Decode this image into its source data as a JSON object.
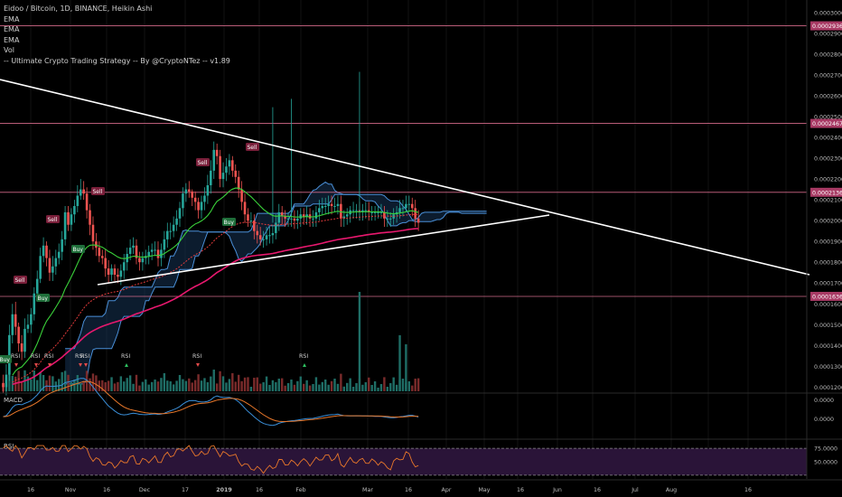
{
  "colors": {
    "background": "#000000",
    "up_candle": "#26a69a",
    "down_candle": "#ef5350",
    "hline": "#d26a8a",
    "price_badge": "#a83a64",
    "cloud": "#4a90d9",
    "ema_fast": "#3ad13a",
    "ema_slow": "#e8186e",
    "trendline": "#ffffff",
    "macd": "#3a8fd9",
    "signal": "#e8772a",
    "rsi": "#e8772a",
    "rsi_band": "#2a1438"
  },
  "header": {
    "title": "Eidoo / Bitcoin, 1D, BINANCE, Heikin Ashi",
    "lines": [
      "EMA",
      "EMA",
      "EMA",
      "Vol",
      "-- Ultimate Crypto Trading Strategy -- By @CryptoNTez -- v1.89"
    ]
  },
  "chart_data": {
    "type": "candlestick",
    "title": "Eidoo / Bitcoin, 1D, BINANCE, Heikin Ashi",
    "price_axis": {
      "ticks": [
        "0.0003000",
        "0.0002900",
        "0.0002800",
        "0.0002700",
        "0.0002600",
        "0.0002500",
        "0.0002400",
        "0.0002300",
        "0.0002200",
        "0.0002100",
        "0.0002000",
        "0.0001900",
        "0.0001800",
        "0.0001700",
        "0.0001600",
        "0.0001500",
        "0.0001400",
        "0.0001300",
        "0.0001200"
      ],
      "range": [
        0.000118,
        0.000306
      ]
    },
    "horizontal_levels": [
      0.0002936,
      0.0002467,
      0.0002136,
      0.0001636
    ],
    "level_labels": [
      "0.0002936",
      "0.0002467",
      "0.0002136",
      "0.0001636"
    ],
    "time_axis": [
      "16",
      "Nov",
      "16",
      "Dec",
      "17",
      "2019",
      "16",
      "Feb",
      "Mar",
      "16",
      "Apr",
      "May",
      "16",
      "Jun",
      "16",
      "Jul",
      "Aug",
      "16"
    ],
    "signals": {
      "sell": [
        "Sell",
        "Sell",
        "Sell",
        "Sell",
        "Sell"
      ],
      "buy": [
        "Buy",
        "Buy",
        "Buy",
        "Buy",
        "Buy"
      ],
      "rsi": [
        "RSI",
        "RSI",
        "RSI",
        "RSI",
        "RSI",
        "RSI",
        "RSI",
        "RSI"
      ]
    },
    "candles": {
      "first_day": "2018-10-05",
      "open": [
        0.000122,
        0.00012,
        0.000126,
        0.000145,
        0.000155,
        0.000149,
        0.000141,
        0.000137,
        0.000148,
        0.00015,
        0.000155,
        0.000165,
        0.000172,
        0.000183,
        0.000188,
        0.000182,
        0.000175,
        0.000178,
        0.000182,
        0.000185,
        0.000191,
        0.000204,
        0.000198,
        0.000203,
        0.000207,
        0.000212,
        0.000215,
        0.000213,
        0.000205,
        0.000198,
        0.00019,
        0.000187,
        0.000183,
        0.000182,
        0.000177,
        0.000174,
        0.000177,
        0.000174,
        0.000173,
        0.000176,
        0.00018,
        0.000184,
        0.000187,
        0.000188,
        0.000182,
        0.00018,
        0.000182,
        0.000183,
        0.000185,
        0.000186,
        0.000186,
        0.000182,
        0.000186,
        0.000191,
        0.000195,
        0.000195,
        0.000198,
        0.000201,
        0.000206,
        0.000213,
        0.000215,
        0.000214,
        0.000211,
        0.000209,
        0.000205,
        0.000209,
        0.000212,
        0.000217,
        0.000224,
        0.000234,
        0.000231,
        0.00022,
        0.000223,
        0.000226,
        0.000229,
        0.000224,
        0.000221,
        0.000215,
        0.000209,
        0.000203,
        0.0002,
        0.0002,
        0.000195,
        0.000193,
        0.000191,
        0.000191,
        0.000193,
        0.000193,
        0.000194,
        0.000199,
        0.000204,
        0.000202,
        0.000201,
        0.000201,
        0.000201,
        0.0002,
        0.000201,
        0.000203,
        0.000202,
        0.000203,
        0.000201,
        0.000201,
        0.000204,
        0.000206,
        0.000207,
        0.000207,
        0.000208,
        0.000207,
        0.000207,
        0.000208,
        0.000201,
        0.000202,
        0.000203,
        0.000205,
        0.000205,
        0.000205,
        0.000204,
        0.000205,
        0.000205,
        0.000204,
        0.000204,
        0.000204,
        0.000204,
        0.000204,
        0.000201,
        0.000201,
        0.000201,
        0.000203,
        0.000204,
        0.000206,
        0.000206,
        0.000208,
        0.000208,
        0.000206,
        0.000201
      ],
      "close": [
        0.00012,
        0.000126,
        0.000145,
        0.000155,
        0.000149,
        0.000141,
        0.000137,
        0.000148,
        0.00015,
        0.000155,
        0.000165,
        0.000172,
        0.000183,
        0.000188,
        0.000182,
        0.000175,
        0.000178,
        0.000182,
        0.000185,
        0.000191,
        0.000204,
        0.000198,
        0.000203,
        0.000207,
        0.000212,
        0.000215,
        0.000213,
        0.000205,
        0.000198,
        0.00019,
        0.000187,
        0.000183,
        0.000182,
        0.000177,
        0.000174,
        0.000177,
        0.000174,
        0.000173,
        0.000176,
        0.00018,
        0.000184,
        0.000187,
        0.000188,
        0.000182,
        0.00018,
        0.000182,
        0.000183,
        0.000185,
        0.000186,
        0.000186,
        0.000182,
        0.000186,
        0.000191,
        0.000195,
        0.000195,
        0.000198,
        0.000201,
        0.000206,
        0.000213,
        0.000215,
        0.000214,
        0.000211,
        0.000209,
        0.000205,
        0.000209,
        0.000212,
        0.000217,
        0.000224,
        0.000234,
        0.000231,
        0.00022,
        0.000223,
        0.000226,
        0.000229,
        0.000224,
        0.000221,
        0.000215,
        0.000209,
        0.000203,
        0.0002,
        0.0002,
        0.000195,
        0.000193,
        0.000191,
        0.000191,
        0.000193,
        0.000193,
        0.000194,
        0.000199,
        0.000204,
        0.000202,
        0.000201,
        0.000201,
        0.000201,
        0.0002,
        0.000201,
        0.000203,
        0.000202,
        0.000203,
        0.000201,
        0.000201,
        0.000204,
        0.000206,
        0.000207,
        0.000207,
        0.000208,
        0.000207,
        0.000207,
        0.000208,
        0.000201,
        0.000202,
        0.000203,
        0.000205,
        0.000205,
        0.000205,
        0.000204,
        0.000205,
        0.000205,
        0.000204,
        0.000204,
        0.000204,
        0.000204,
        0.000204,
        0.000201,
        0.000201,
        0.000201,
        0.000203,
        0.000204,
        0.000206,
        0.000206,
        0.000208,
        0.000208,
        0.000206,
        0.000201,
        0.000199
      ],
      "wick_high": [
        0.000126,
        0.000131,
        0.00015,
        0.00016,
        0.000161,
        0.000151,
        0.000145,
        0.000153,
        0.000155,
        0.000158,
        0.000168,
        0.000176,
        0.000187,
        0.000192,
        0.00019,
        0.000186,
        0.000183,
        0.000186,
        0.000189,
        0.000195,
        0.000207,
        0.000207,
        0.000206,
        0.00021,
        0.000217,
        0.00022,
        0.000219,
        0.000216,
        0.000208,
        0.000202,
        0.000194,
        0.00019,
        0.000186,
        0.000186,
        0.000181,
        0.000179,
        0.000179,
        0.000177,
        0.000179,
        0.000184,
        0.000187,
        0.000191,
        0.000192,
        0.000191,
        0.000185,
        0.000185,
        0.000186,
        0.000188,
        0.000189,
        0.00019,
        0.00019,
        0.000189,
        0.000195,
        0.000199,
        0.000199,
        0.000202,
        0.000205,
        0.000209,
        0.000216,
        0.000218,
        0.000219,
        0.000215,
        0.000214,
        0.000211,
        0.000212,
        0.000216,
        0.000222,
        0.000229,
        0.000238,
        0.000237,
        0.000234,
        0.000228,
        0.00023,
        0.000232,
        0.000231,
        0.000227,
        0.000224,
        0.000219,
        0.000213,
        0.000206,
        0.000204,
        0.000203,
        0.000198,
        0.000197,
        0.000195,
        0.000197,
        0.000197,
        0.000198,
        0.000203,
        0.000208,
        0.000207,
        0.000205,
        0.000204,
        0.000205,
        0.000205,
        0.000205,
        0.000206,
        0.000206,
        0.000207,
        0.000206,
        0.000205,
        0.000207,
        0.00021,
        0.000211,
        0.000211,
        0.000212,
        0.000212,
        0.000211,
        0.000212,
        0.000212,
        0.000205,
        0.000206,
        0.000207,
        0.000209,
        0.000208,
        0.000209,
        0.000208,
        0.000209,
        0.000209,
        0.000207,
        0.000207,
        0.000207,
        0.000208,
        0.000207,
        0.000205,
        0.000204,
        0.000206,
        0.000207,
        0.00021,
        0.00021,
        0.000212,
        0.000212,
        0.000211,
        0.00021,
        0.000205
      ],
      "wick_low": [
        0.000117,
        0.000116,
        0.000123,
        0.000141,
        0.000145,
        0.000137,
        0.000133,
        0.000134,
        0.000146,
        0.000146,
        0.000152,
        0.000161,
        0.00017,
        0.00018,
        0.000178,
        0.000171,
        0.000171,
        0.000174,
        0.000179,
        0.000181,
        0.000188,
        0.000195,
        0.000195,
        0.000199,
        0.000204,
        0.00021,
        0.00021,
        0.000201,
        0.000193,
        0.000186,
        0.000183,
        0.00018,
        0.000179,
        0.000173,
        0.00017,
        0.000171,
        0.000171,
        0.00017,
        0.000169,
        0.000172,
        0.000176,
        0.000181,
        0.000184,
        0.000179,
        0.000176,
        0.000176,
        0.000179,
        0.000179,
        0.000181,
        0.000183,
        0.000178,
        0.000178,
        0.000182,
        0.000187,
        0.000191,
        0.000192,
        0.000195,
        0.000197,
        0.000202,
        0.000209,
        0.000211,
        0.000207,
        0.000205,
        0.000201,
        0.000201,
        0.000205,
        0.000208,
        0.000213,
        0.00022,
        0.000227,
        0.000216,
        0.000216,
        0.000219,
        0.000222,
        0.000221,
        0.000218,
        0.000211,
        0.000205,
        0.000199,
        0.000197,
        0.000197,
        0.000191,
        0.000189,
        0.000188,
        0.000187,
        0.000188,
        0.000189,
        0.000189,
        0.000191,
        0.000195,
        0.000198,
        0.000197,
        0.000197,
        0.000197,
        0.000196,
        0.000196,
        0.000197,
        0.000198,
        0.000198,
        0.000197,
        0.000197,
        0.000197,
        0.0002,
        0.000203,
        0.000203,
        0.000203,
        0.000203,
        0.000204,
        0.000203,
        0.000197,
        0.000197,
        0.000198,
        0.000199,
        0.000201,
        0.000201,
        0.0002,
        0.0002,
        0.000201,
        0.0002,
        0.0002,
        0.0002,
        0.000201,
        0.000201,
        0.000197,
        0.000197,
        0.000197,
        0.000198,
        0.000199,
        0.000201,
        0.000202,
        0.000204,
        0.000204,
        0.000202,
        0.000197,
        0.000195
      ]
    },
    "volume_panel": {
      "type": "bar",
      "note": "volume histogram at bottom of price pane"
    },
    "macd_panel": {
      "title": "MACD",
      "ticks": [
        "0.0000",
        "0.0000"
      ]
    },
    "rsi_panel": {
      "title": "RSI",
      "ticks": [
        "75.0000",
        "50.0000"
      ],
      "bands": [
        75,
        25
      ]
    }
  }
}
